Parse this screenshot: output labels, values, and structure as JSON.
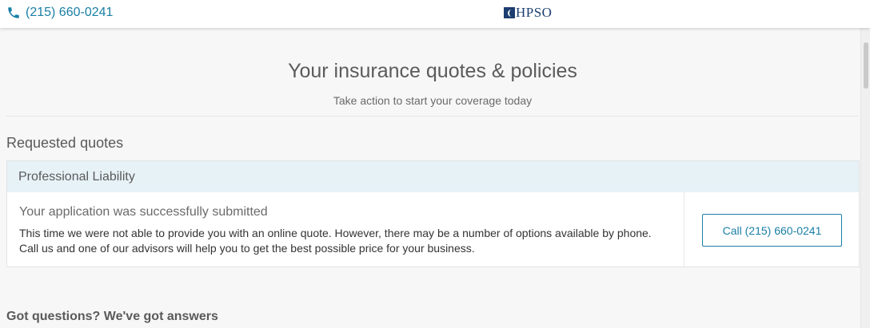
{
  "topbar": {
    "phone": "(215) 660-0241",
    "phone_icon": "phone-icon",
    "logo_text": "HPSO",
    "logo_icon": "hpso-logo-mark",
    "brand_color": "#1c3e70",
    "accent_color": "#1a7fa6"
  },
  "header": {
    "title": "Your insurance quotes & policies",
    "subtitle": "Take action to start your coverage today"
  },
  "requested_quotes": {
    "section_title": "Requested quotes",
    "card": {
      "header": "Professional Liability",
      "status": "Your application was successfully submitted",
      "message": "This time we were not able to provide you with an online quote. However, there may be a number of options available by phone. Call us and one of our advisors will help you to get the best possible price for your business.",
      "call_button_label": "Call (215) 660-0241"
    }
  },
  "faq": {
    "title": "Got questions? We've got answers"
  }
}
